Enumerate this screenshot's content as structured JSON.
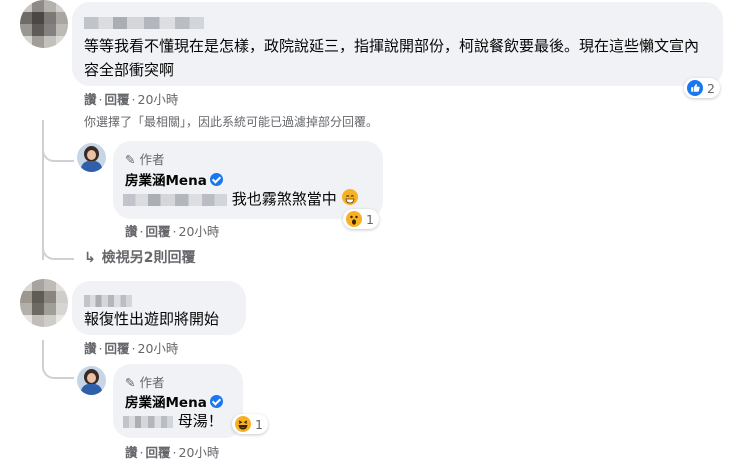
{
  "comments": [
    {
      "text": "等等我看不懂現在是怎樣，政院說延三，指揮說開部份，柯說餐飲要最後。現在這些懶文宣內容全部衝突啊",
      "like_label": "讚",
      "reply_label": "回覆",
      "time": "20小時",
      "reaction_count": "2"
    },
    {
      "text": "報復性出遊即將開始",
      "like_label": "讚",
      "reply_label": "回覆",
      "time": "20小時"
    }
  ],
  "filter_notice": "你選擇了「最相關」，因此系統可能已過濾掉部分回覆。",
  "view_more_replies": "檢視另2則回覆",
  "replies": [
    {
      "author_tag": "作者",
      "author_name": "房業涵Mena",
      "text": "我也霧煞煞當中",
      "like_label": "讚",
      "reply_label": "回覆",
      "time": "20小時",
      "reaction_count": "1",
      "reaction_icon": "wow-icon"
    },
    {
      "author_tag": "作者",
      "author_name": "房業涵Mena",
      "text": "母湯！",
      "like_label": "讚",
      "reply_label": "回覆",
      "time": "20小時",
      "reaction_count": "1",
      "reaction_icon": "haha-icon"
    }
  ],
  "colors": {
    "bubble": "#f0f2f5",
    "meta": "#65676b",
    "like_blue": "#1877f2",
    "emoji_yellow": "#f7b125"
  }
}
